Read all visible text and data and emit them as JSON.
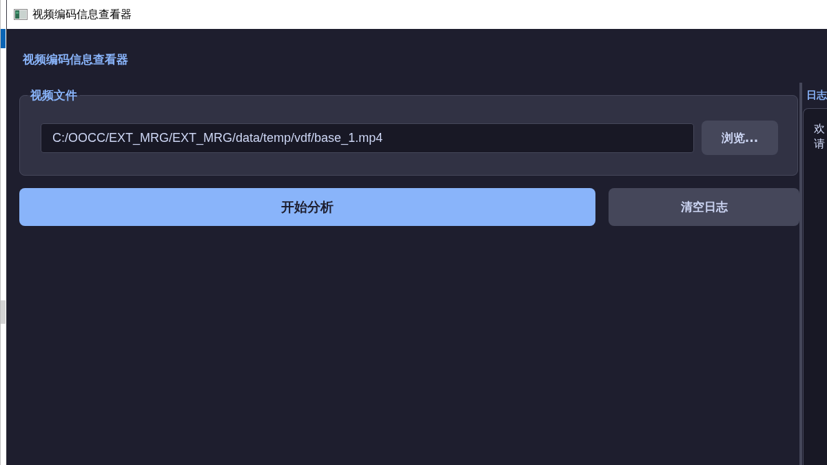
{
  "window": {
    "title": "视频编码信息查看器"
  },
  "heading": "视频编码信息查看器",
  "file_group": {
    "title": "视频文件",
    "path_field": {
      "value": "C:/OOCC/EXT_MRG/EXT_MRG/data/temp/vdf/base_1.mp4"
    },
    "browse_button": "浏览..."
  },
  "actions": [
    {
      "label": "开始分析",
      "kind": "primary"
    },
    {
      "label": "清空日志",
      "kind": "secondary"
    }
  ],
  "log_panel": {
    "title": "日志",
    "lines": [
      "欢",
      "请"
    ]
  }
}
